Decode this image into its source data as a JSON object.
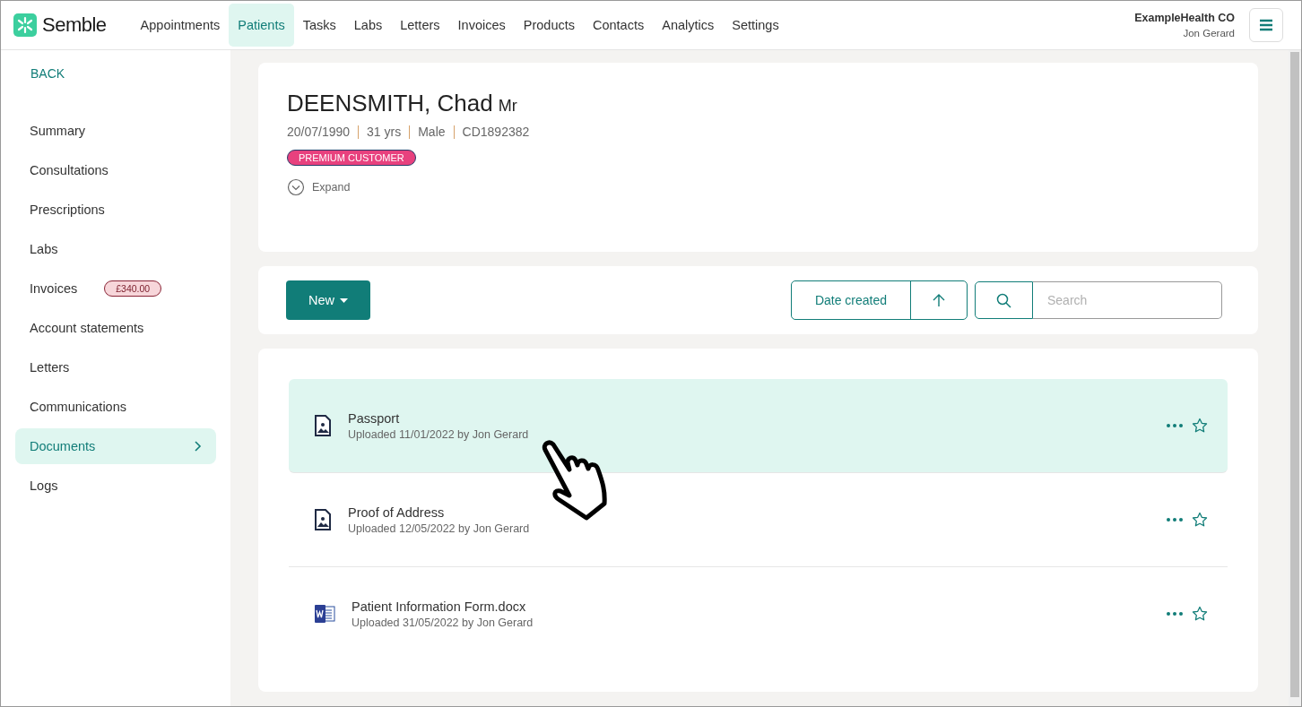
{
  "brand": {
    "name": "Semble"
  },
  "nav": [
    {
      "label": "Appointments",
      "selected": false
    },
    {
      "label": "Patients",
      "selected": true
    },
    {
      "label": "Tasks",
      "selected": false
    },
    {
      "label": "Labs",
      "selected": false
    },
    {
      "label": "Letters",
      "selected": false
    },
    {
      "label": "Invoices",
      "selected": false
    },
    {
      "label": "Products",
      "selected": false
    },
    {
      "label": "Contacts",
      "selected": false
    },
    {
      "label": "Analytics",
      "selected": false
    },
    {
      "label": "Settings",
      "selected": false
    }
  ],
  "account": {
    "organisation": "ExampleHealth CO",
    "user": "Jon Gerard"
  },
  "sidebar": {
    "back": "BACK",
    "items": [
      {
        "label": "Summary",
        "selected": false
      },
      {
        "label": "Consultations",
        "selected": false
      },
      {
        "label": "Prescriptions",
        "selected": false
      },
      {
        "label": "Labs",
        "selected": false
      },
      {
        "label": "Invoices",
        "selected": false,
        "badge": "£340.00"
      },
      {
        "label": "Account statements",
        "selected": false
      },
      {
        "label": "Letters",
        "selected": false
      },
      {
        "label": "Communications",
        "selected": false
      },
      {
        "label": "Documents",
        "selected": true
      },
      {
        "label": "Logs",
        "selected": false
      }
    ]
  },
  "patient": {
    "name": "DEENSMITH, Chad",
    "title": "Mr",
    "details": [
      "20/07/1990",
      "31 yrs",
      "Male",
      "CD1892382"
    ],
    "tag": "PREMIUM CUSTOMER",
    "expand": "Expand"
  },
  "toolbar": {
    "new_button": "New",
    "sort": "Date created",
    "search": {
      "placeholder": "Search"
    }
  },
  "documents": [
    {
      "kind": "image",
      "name": "Passport",
      "meta": "Uploaded 11/01/2022 by Jon Gerard",
      "selected": true
    },
    {
      "kind": "image",
      "name": "Proof of Address",
      "meta": "Uploaded 12/05/2022 by Jon Gerard",
      "selected": false
    },
    {
      "kind": "word",
      "name": "Patient Information Form.docx",
      "meta": "Uploaded 31/05/2022 by Jon Gerard",
      "selected": false
    }
  ]
}
